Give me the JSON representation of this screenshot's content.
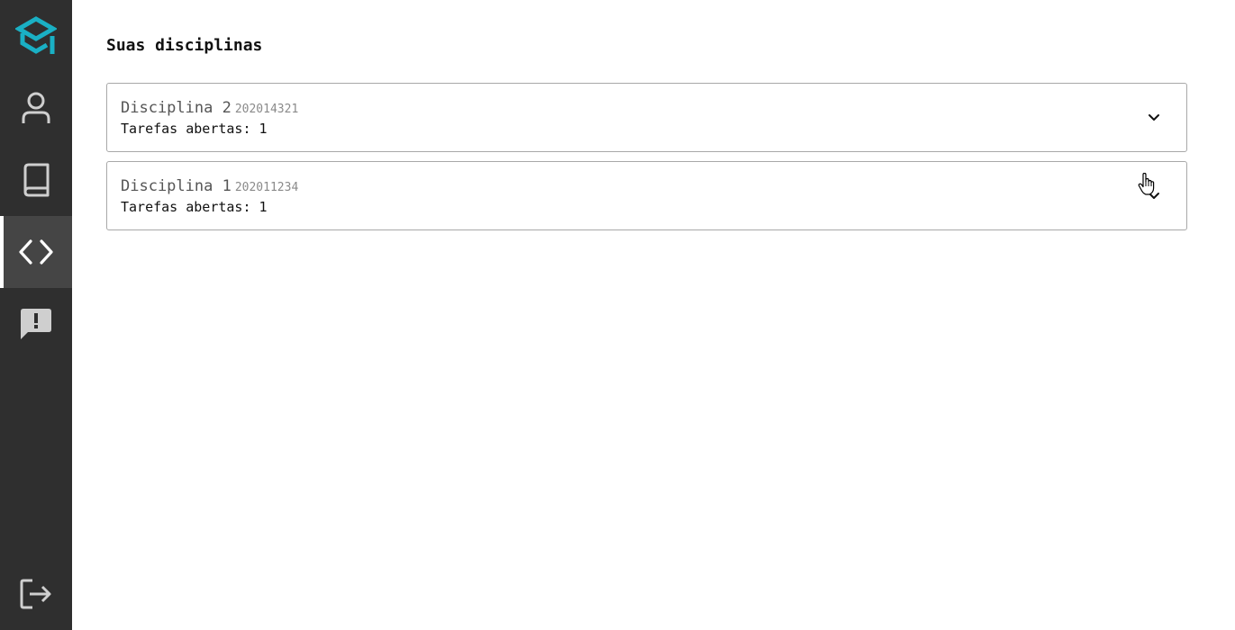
{
  "app": {
    "logo_icon": "graduation-cap-code-icon",
    "accent_color": "#1ab0c4",
    "sidebar_bg": "#2f2f2f",
    "active_item_bg": "#454545"
  },
  "sidebar": {
    "items": [
      {
        "id": "profile",
        "icon": "user-icon",
        "active": false
      },
      {
        "id": "book",
        "icon": "book-icon",
        "active": false
      },
      {
        "id": "code",
        "icon": "code-icon",
        "active": true
      },
      {
        "id": "feedback",
        "icon": "feedback-icon",
        "active": false
      }
    ],
    "logout_icon": "logout-icon"
  },
  "main": {
    "title": "Suas disciplinas",
    "courses": [
      {
        "name": "Disciplina 2",
        "code": "202014321",
        "tasks_label": "Tarefas abertas: 1",
        "expand_icon": "chevron-down-icon"
      },
      {
        "name": "Disciplina 1",
        "code": "202011234",
        "tasks_label": "Tarefas abertas: 1",
        "expand_icon": "chevron-down-icon"
      }
    ]
  }
}
